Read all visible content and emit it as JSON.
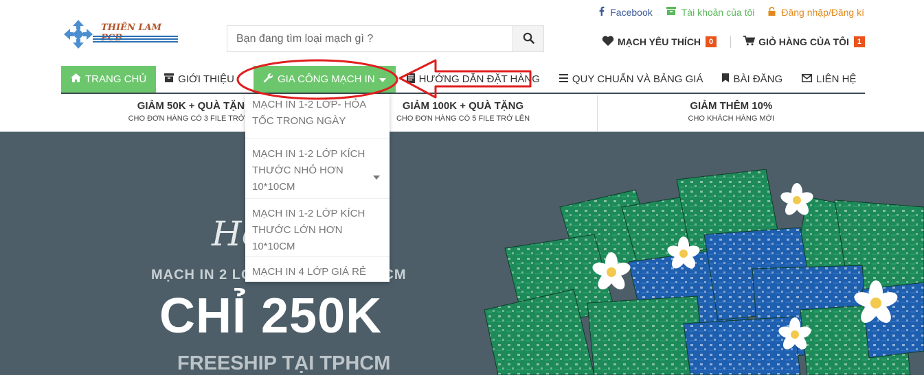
{
  "colors": {
    "accent_green": "#6cc76c",
    "badge_orange": "#e8541c",
    "hero_bg": "#4d5e68",
    "annotation_red": "#e01e1e",
    "facebook_blue": "#3b5998"
  },
  "topbar": {
    "facebook": {
      "label": "Facebook",
      "icon": "facebook-icon"
    },
    "account": {
      "label": "Tài khoản của tôi",
      "icon": "account-icon"
    },
    "login": {
      "label": "Đăng nhập/Đăng kí",
      "icon": "lock-icon"
    }
  },
  "logo": {
    "text": "THIÊN LAM PCB",
    "icon": "logo-arrows-icon"
  },
  "search": {
    "placeholder": "Bạn đang tìm loại mạch gì ?",
    "value": "",
    "icon": "search-icon"
  },
  "header_actions": {
    "wishlist": {
      "label": "MẠCH YÊU THÍCH",
      "count": "0",
      "icon": "heart-icon"
    },
    "cart": {
      "label": "GIỎ HÀNG CỦA TÔI",
      "count": "1",
      "icon": "cart-icon"
    }
  },
  "nav": {
    "items": [
      {
        "label": "TRANG CHỦ",
        "icon": "home-icon"
      },
      {
        "label": "GIỚI THIỆU",
        "icon": "archive-icon"
      },
      {
        "label": "GIA CÔNG MẠCH IN",
        "icon": "wrench-icon"
      },
      {
        "label": "HƯỚNG DẪN ĐẶT HÀNG",
        "icon": "doc-icon"
      },
      {
        "label": "QUY CHUẨN VÀ BẢNG GIÁ",
        "icon": "list-icon"
      },
      {
        "label": "BÀI ĐĂNG",
        "icon": "bookmark-icon"
      },
      {
        "label": "LIÊN HỆ",
        "icon": "envelope-icon"
      }
    ]
  },
  "dropdown": {
    "items": [
      {
        "line1": "MẠCH IN 1-2 LỚP- HỎA",
        "line2": "TỐC TRONG NGÀY",
        "line3": ""
      },
      {
        "line1": "MẠCH IN 1-2 LỚP KÍCH",
        "line2": "THƯỚC NHỎ HƠN",
        "line3": "10*10CM"
      },
      {
        "line1": "MẠCH IN 1-2 LỚP KÍCH",
        "line2": "THƯỚC LỚN HƠN",
        "line3": "10*10CM"
      },
      {
        "line1": "MẠCH IN 4 LỚP GIÁ RẺ",
        "line2": "",
        "line3": ""
      }
    ]
  },
  "promos": [
    {
      "title": "GIẢM 50K + QUÀ TẶNG",
      "subtitle": "CHO ĐƠN HÀNG CÓ 3 FILE TRỞ LÊN"
    },
    {
      "title": "GIẢM 100K + QUÀ TẶNG",
      "subtitle": "CHO ĐƠN HÀNG CÓ 5 FILE TRỞ LÊN"
    },
    {
      "title": "GIẢM THÊM 10%",
      "subtitle": "CHO KHÁCH HÀNG MỚI"
    }
  ],
  "hero": {
    "script": "Ho",
    "line1": "MẠCH IN 2 LỚ",
    "line1_end": "10CM",
    "price": "CHỈ 250K",
    "shipping": "FREESHIP TẠI TPHCM"
  }
}
